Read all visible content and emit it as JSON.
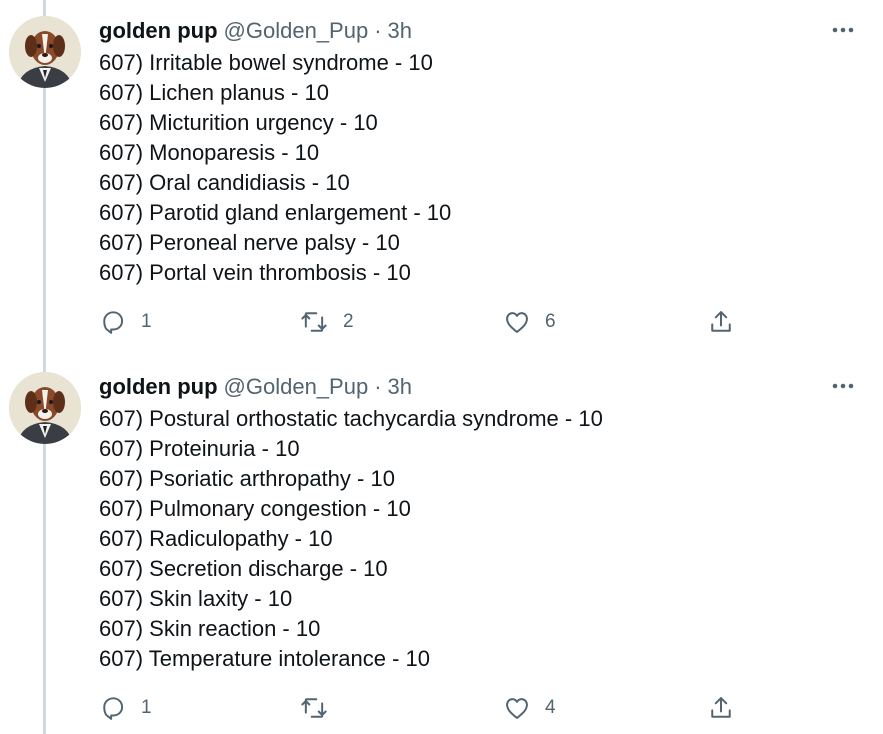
{
  "tweets": [
    {
      "author": {
        "display_name": "golden pup",
        "handle": "@Golden_Pup",
        "separator": "·",
        "time": "3h",
        "avatar_icon": "dog-avatar-icon"
      },
      "lines": [
        "607) Irritable bowel syndrome - 10",
        "607) Lichen planus - 10",
        "607) Micturition urgency - 10",
        "607) Monoparesis - 10",
        "607) Oral candidiasis - 10",
        "607) Parotid gland enlargement - 10",
        "607) Peroneal nerve palsy - 10",
        "607) Portal vein thrombosis - 10"
      ],
      "actions": {
        "reply_count": "1",
        "retweet_count": "2",
        "like_count": "6"
      }
    },
    {
      "author": {
        "display_name": "golden pup",
        "handle": "@Golden_Pup",
        "separator": "·",
        "time": "3h",
        "avatar_icon": "dog-avatar-icon"
      },
      "lines": [
        "607) Postural orthostatic tachycardia syndrome - 10",
        "607) Proteinuria - 10",
        "607) Psoriatic arthropathy - 10",
        "607) Pulmonary congestion - 10",
        "607) Radiculopathy - 10",
        "607) Secretion discharge - 10",
        "607) Skin laxity - 10",
        "607) Skin reaction - 10",
        "607) Temperature intolerance - 10"
      ],
      "actions": {
        "reply_count": "1",
        "retweet_count": "",
        "like_count": "4"
      }
    }
  ],
  "icons": {
    "more": "more-options-icon",
    "reply": "reply-icon",
    "retweet": "retweet-icon",
    "like": "heart-icon",
    "share": "share-icon"
  },
  "colors": {
    "text_primary": "#0f1419",
    "text_secondary": "#536471",
    "thread_line": "#cfd9de",
    "background": "#ffffff"
  }
}
